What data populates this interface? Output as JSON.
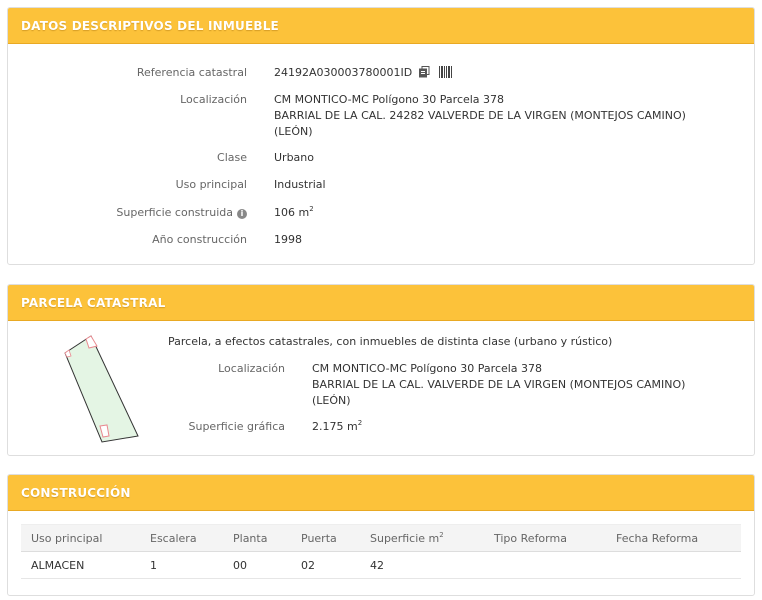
{
  "descriptive": {
    "title": "DATOS DESCRIPTIVOS DEL INMUEBLE",
    "fields": [
      {
        "label": "Referencia catastral",
        "value": "24192A030003780001ID"
      },
      {
        "label": "Localización",
        "lines": [
          "CM MONTICO-MC Polígono 30 Parcela 378",
          "BARRIAL DE LA CAL. 24282 VALVERDE DE LA VIRGEN (MONTEJOS CAMINO)",
          "(LEÓN)"
        ]
      },
      {
        "label": "Clase",
        "value": "Urbano"
      },
      {
        "label": "Uso principal",
        "value": "Industrial"
      },
      {
        "label": "Superficie construida",
        "value": "106 m",
        "unit_sup": "2"
      },
      {
        "label": "Año construcción",
        "value": "1998"
      }
    ],
    "icons": [
      "copy-icon",
      "barcode-icon",
      "info-icon"
    ]
  },
  "parcel": {
    "title": "PARCELA CATASTRAL",
    "description": "Parcela, a efectos catastrales, con inmuebles de distinta clase (urbano y rústico)",
    "location_label": "Localización",
    "location_lines": [
      "CM MONTICO-MC Polígono 30 Parcela 378",
      "BARRIAL DE LA CAL. VALVERDE DE LA VIRGEN (MONTEJOS CAMINO)",
      "(LEÓN)"
    ],
    "area_label": "Superficie gráfica",
    "area_value": "2.175 m",
    "area_sup": "2"
  },
  "construction": {
    "title": "CONSTRUCCIÓN",
    "columns": [
      "Uso principal",
      "Escalera",
      "Planta",
      "Puerta",
      "Superficie m",
      "Tipo Reforma",
      "Fecha Reforma"
    ],
    "surface_sup": "2",
    "rows": [
      [
        "ALMACEN",
        "1",
        "00",
        "02",
        "42",
        "",
        ""
      ]
    ]
  },
  "colors": {
    "header_bg": "#fcc23a",
    "header_text": "#ffffff",
    "parcel_fill": "#e4f5e4",
    "parcel_marker": "#e9898f"
  }
}
